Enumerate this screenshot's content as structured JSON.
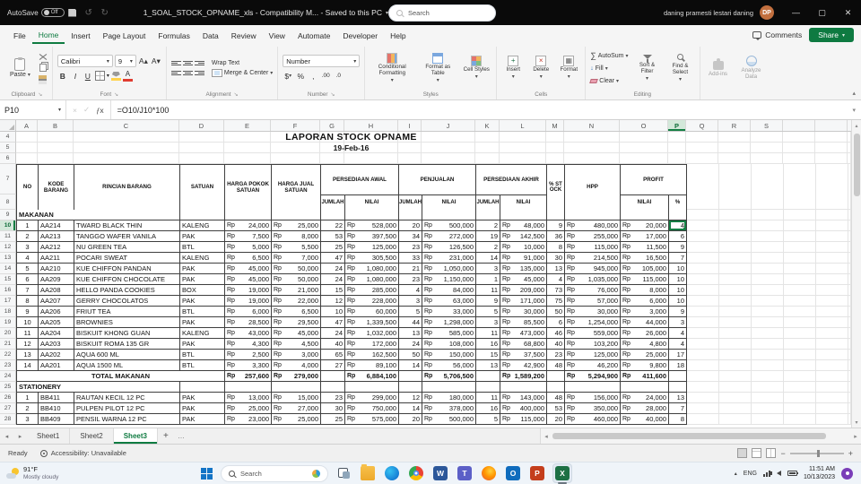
{
  "title_bar": {
    "autosave_label": "AutoSave",
    "autosave_state": "Off",
    "doc_title": "1_SOAL_STOCK_OPNAME_xls  -  Compatibility M...  -  Saved to this PC",
    "search_placeholder": "Search",
    "user_name": "daning pramesti lestari daning",
    "user_initials": "DP"
  },
  "menu": {
    "tabs": [
      "File",
      "Home",
      "Insert",
      "Page Layout",
      "Formulas",
      "Data",
      "Review",
      "View",
      "Automate",
      "Developer",
      "Help"
    ],
    "active_tab": "Home",
    "comments_label": "Comments",
    "share_label": "Share"
  },
  "ribbon": {
    "paste": "Paste",
    "font_name": "Calibri",
    "font_size": "9",
    "wrap_text": "Wrap Text",
    "merge_center": "Merge & Center",
    "number_format": "Number",
    "conditional_formatting": "Conditional Formatting",
    "format_as_table": "Format as Table",
    "cell_styles": "Cell Styles",
    "insert": "Insert",
    "delete": "Delete",
    "format": "Format",
    "autosum": "AutoSum",
    "fill": "Fill",
    "clear": "Clear",
    "sort_filter": "Sort & Filter",
    "find_select": "Find & Select",
    "addins": "Add-ins",
    "analyze_data": "Analyze Data",
    "group_labels": [
      "Clipboard",
      "Font",
      "Alignment",
      "Number",
      "Styles",
      "Cells",
      "Editing"
    ]
  },
  "formula_bar": {
    "name_box": "P10",
    "fx_label": "fx",
    "formula": "=O10/J10*100"
  },
  "sheet": {
    "columns": [
      "A",
      "B",
      "C",
      "D",
      "E",
      "F",
      "G",
      "H",
      "I",
      "J",
      "K",
      "L",
      "M",
      "N",
      "O",
      "P",
      "Q",
      "R",
      "S"
    ],
    "selected_column": "P",
    "selected_row": 10,
    "selected_cell": "P10",
    "title": "LAPORAN STOCK OPNAME",
    "subtitle": "19-Feb-16",
    "currency": "Rp",
    "header": {
      "no": "NO",
      "kode": "KODE BARANG",
      "rincian": "RINCIAN BARANG",
      "satuan": "SATUAN",
      "harga_pokok": "HARGA POKOK SATUAN",
      "harga_jual": "HARGA JUAL SATUAN",
      "persediaan_awal": "PERSEDIAAN AWAL",
      "penjualan": "PENJUALAN",
      "persediaan_akhir": "PERSEDIAAN AKHIR",
      "stock_pct": "% STOCK",
      "hpp": "HPP",
      "profit": "PROFIT",
      "jumlah": "JUMLAH",
      "nilai": "NILAI",
      "pct": "%"
    },
    "rows": [
      {
        "row": 4,
        "type": "title"
      },
      {
        "row": 5,
        "type": "subtitle"
      },
      {
        "row": 6,
        "type": "blank"
      },
      {
        "row": 7,
        "type": "header"
      },
      {
        "row": 8,
        "type": "subheader"
      },
      {
        "row": 9,
        "type": "section",
        "label": "MAKANAN"
      },
      {
        "row": 10,
        "type": "data",
        "c": [
          "1",
          "AA214",
          "TWARD BLACK THIN",
          "KALENG",
          "24,000",
          "25,000",
          "22",
          "528,000",
          "20",
          "500,000",
          "2",
          "48,000",
          "9",
          "480,000",
          "20,000",
          "4"
        ]
      },
      {
        "row": 11,
        "type": "data",
        "c": [
          "2",
          "AA213",
          "TANGGO WAFER VANILA",
          "PAK",
          "7,500",
          "8,000",
          "53",
          "397,500",
          "34",
          "272,000",
          "19",
          "142,500",
          "36",
          "255,000",
          "17,000",
          "6"
        ]
      },
      {
        "row": 12,
        "type": "data",
        "c": [
          "3",
          "AA212",
          "NU GREEN TEA",
          "BTL",
          "5,000",
          "5,500",
          "25",
          "125,000",
          "23",
          "126,500",
          "2",
          "10,000",
          "8",
          "115,000",
          "11,500",
          "9"
        ]
      },
      {
        "row": 13,
        "type": "data",
        "c": [
          "4",
          "AA211",
          "POCARI SWEAT",
          "KALENG",
          "6,500",
          "7,000",
          "47",
          "305,500",
          "33",
          "231,000",
          "14",
          "91,000",
          "30",
          "214,500",
          "16,500",
          "7"
        ]
      },
      {
        "row": 14,
        "type": "data",
        "c": [
          "5",
          "AA210",
          "KUE CHIFFON PANDAN",
          "PAK",
          "45,000",
          "50,000",
          "24",
          "1,080,000",
          "21",
          "1,050,000",
          "3",
          "135,000",
          "13",
          "945,000",
          "105,000",
          "10"
        ]
      },
      {
        "row": 15,
        "type": "data",
        "c": [
          "6",
          "AA209",
          "KUE CHIFFON CHOCOLATE",
          "PAK",
          "45,000",
          "50,000",
          "24",
          "1,080,000",
          "23",
          "1,150,000",
          "1",
          "45,000",
          "4",
          "1,035,000",
          "115,000",
          "10"
        ]
      },
      {
        "row": 16,
        "type": "data",
        "c": [
          "7",
          "AA208",
          "HELLO PANDA COOKIES",
          "BOX",
          "19,000",
          "21,000",
          "15",
          "285,000",
          "4",
          "84,000",
          "11",
          "209,000",
          "73",
          "76,000",
          "8,000",
          "10"
        ]
      },
      {
        "row": 17,
        "type": "data",
        "c": [
          "8",
          "AA207",
          "GERRY CHOCOLATOS",
          "PAK",
          "19,000",
          "22,000",
          "12",
          "228,000",
          "3",
          "63,000",
          "9",
          "171,000",
          "75",
          "57,000",
          "6,000",
          "10"
        ]
      },
      {
        "row": 18,
        "type": "data",
        "c": [
          "9",
          "AA206",
          "FRIUT TEA",
          "BTL",
          "6,000",
          "6,500",
          "10",
          "60,000",
          "5",
          "33,000",
          "5",
          "30,000",
          "50",
          "30,000",
          "3,000",
          "9"
        ]
      },
      {
        "row": 19,
        "type": "data",
        "c": [
          "10",
          "AA205",
          "BROWNIES",
          "PAK",
          "28,500",
          "29,500",
          "47",
          "1,339,500",
          "44",
          "1,298,000",
          "3",
          "85,500",
          "6",
          "1,254,000",
          "44,000",
          "3"
        ]
      },
      {
        "row": 20,
        "type": "data",
        "c": [
          "11",
          "AA204",
          "BISKUIT KHONG GUAN",
          "KALENG",
          "43,000",
          "45,000",
          "24",
          "1,032,000",
          "13",
          "585,000",
          "11",
          "473,000",
          "46",
          "559,000",
          "26,000",
          "4"
        ]
      },
      {
        "row": 21,
        "type": "data",
        "c": [
          "12",
          "AA203",
          "BISKUIT ROMA 135 GR",
          "PAK",
          "4,300",
          "4,500",
          "40",
          "172,000",
          "24",
          "108,000",
          "16",
          "68,800",
          "40",
          "103,200",
          "4,800",
          "4"
        ]
      },
      {
        "row": 22,
        "type": "data",
        "c": [
          "13",
          "AA202",
          "AQUA 600 ML",
          "BTL",
          "2,500",
          "3,000",
          "65",
          "162,500",
          "50",
          "150,000",
          "15",
          "37,500",
          "23",
          "125,000",
          "25,000",
          "17"
        ]
      },
      {
        "row": 23,
        "type": "data",
        "c": [
          "14",
          "AA201",
          "AQUA 1500 ML",
          "BTL",
          "3,300",
          "4,000",
          "27",
          "89,100",
          "14",
          "56,000",
          "13",
          "42,900",
          "48",
          "46,200",
          "9,800",
          "18"
        ]
      },
      {
        "row": 24,
        "type": "total",
        "c": [
          "",
          "",
          "TOTAL MAKANAN",
          "",
          "257,600",
          "279,000",
          "",
          "6,884,100",
          "",
          "5,706,500",
          "",
          "1,589,200",
          "",
          "5,294,900",
          "411,600",
          ""
        ]
      },
      {
        "row": 25,
        "type": "section",
        "label": "STATIONERY"
      },
      {
        "row": 26,
        "type": "data",
        "c": [
          "1",
          "BB411",
          "RAUTAN KECIL 12 PC",
          "PAK",
          "13,000",
          "15,000",
          "23",
          "299,000",
          "12",
          "180,000",
          "11",
          "143,000",
          "48",
          "156,000",
          "24,000",
          "13"
        ]
      },
      {
        "row": 27,
        "type": "data",
        "c": [
          "2",
          "BB410",
          "PULPEN PILOT 12 PC",
          "PAK",
          "25,000",
          "27,000",
          "30",
          "750,000",
          "14",
          "378,000",
          "16",
          "400,000",
          "53",
          "350,000",
          "28,000",
          "7"
        ]
      },
      {
        "row": 28,
        "type": "data",
        "c": [
          "3",
          "BB409",
          "PENSIL WARNA 12 PC",
          "PAK",
          "23,000",
          "25,000",
          "25",
          "575,000",
          "20",
          "500,000",
          "5",
          "115,000",
          "20",
          "460,000",
          "40,000",
          "8"
        ]
      }
    ]
  },
  "sheet_tabs": {
    "tabs": [
      "Sheet1",
      "Sheet2",
      "Sheet3"
    ],
    "active": "Sheet3",
    "add_label": "+"
  },
  "status_bar": {
    "mode": "Ready",
    "accessibility": "Accessibility: Unavailable"
  },
  "taskbar": {
    "weather_temp": "91°F",
    "weather_desc": "Mostly cloudy",
    "search_label": "Search",
    "apps": [
      "task-view",
      "file-explorer",
      "edge",
      "chrome",
      "word",
      "teams",
      "firefox",
      "outlook",
      "powerpoint",
      "excel"
    ],
    "active_app": "excel",
    "tray_lang": "ENG",
    "time": "11:51 AM",
    "date": "10/13/2023"
  },
  "colors": {
    "excel_green": "#107c41",
    "titlebar_bg": "#0a0a0a",
    "share_button": "#0e7a41",
    "avatar": "#c2703f",
    "selection": "#137e43",
    "notification": "#7a3db8"
  }
}
